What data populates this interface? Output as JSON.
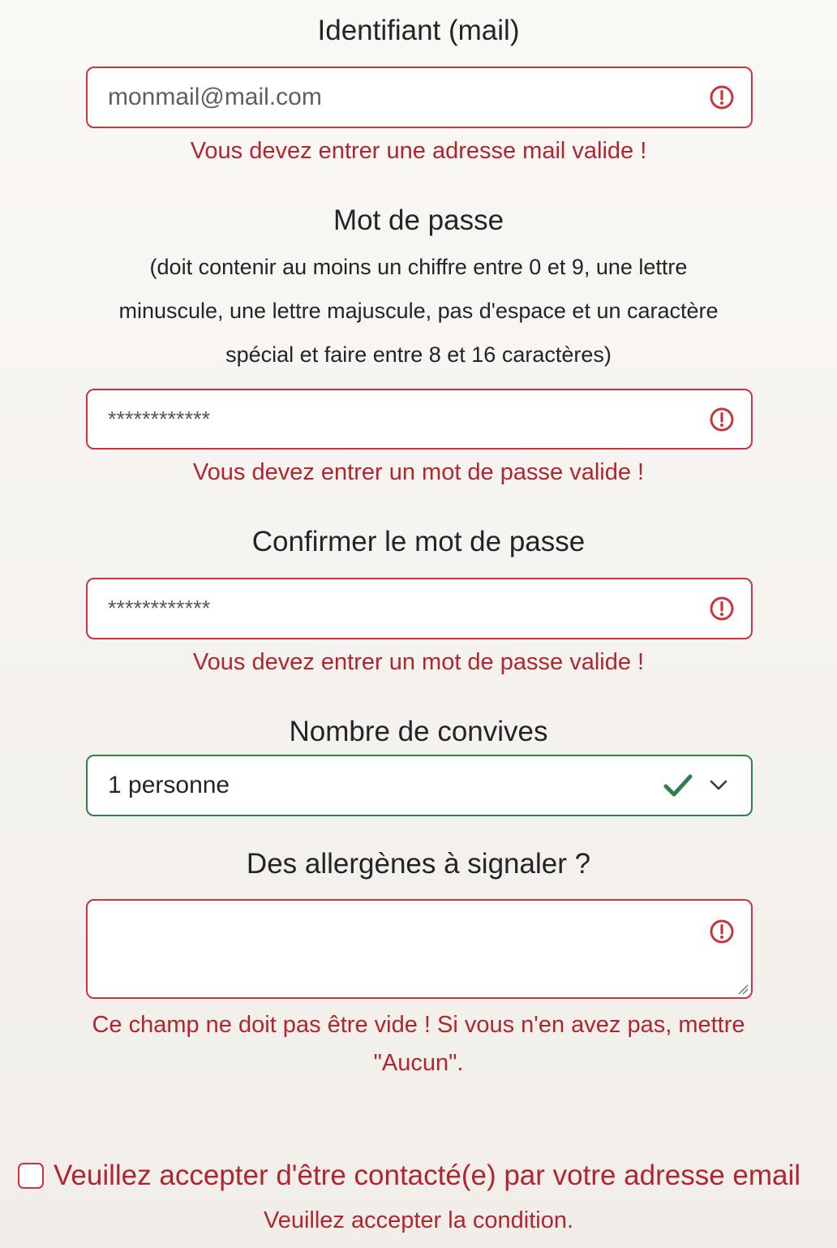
{
  "email": {
    "label": "Identifiant (mail)",
    "value": "monmail@mail.com",
    "error": "Vous devez entrer une adresse mail valide !"
  },
  "password": {
    "label": "Mot de passe",
    "hint": "(doit contenir au moins un chiffre entre 0 et 9, une lettre minuscule, une lettre majuscule, pas d'espace et un caractère spécial et faire entre 8 et 16 caractères)",
    "value": "************",
    "error": "Vous devez entrer un mot de passe valide !"
  },
  "confirm_password": {
    "label": "Confirmer le mot de passe",
    "value": "************",
    "error": "Vous devez entrer un mot de passe valide !"
  },
  "guests": {
    "label": "Nombre de convives",
    "selected": "1 personne"
  },
  "allergens": {
    "label": "Des allergènes à signaler ?",
    "value": "",
    "error": "Ce champ ne doit pas être vide ! Si vous n'en avez pas, mettre \"Aucun\"."
  },
  "consent": {
    "label": "Veuillez accepter d'être contacté(e) par votre adresse email",
    "checked": false,
    "error": "Veuillez accepter la condition."
  },
  "colors": {
    "error": "#b0262f",
    "error_border": "#c9353f",
    "valid": "#2e8049",
    "text": "#212529",
    "background": "#f4f1ed"
  },
  "icons": {
    "error": "exclamation-circle-icon",
    "valid": "checkmark-icon",
    "select": "chevron-down-icon"
  }
}
